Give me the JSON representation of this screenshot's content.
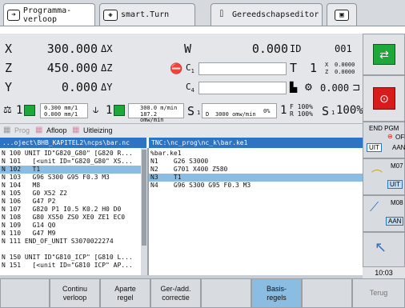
{
  "tabs": [
    {
      "label": "Programma-verloop",
      "icon": "arrow-right-icon"
    },
    {
      "label": "smart.Turn",
      "icon": "diamond-arrow-icon"
    },
    {
      "label": "Gereedschapseditor",
      "icon": "tool-icon"
    },
    {
      "label": "",
      "icon": "save-icon"
    }
  ],
  "positions": {
    "x_axis": "X",
    "x_val": "300.000",
    "x_delta": "ΔX",
    "z_axis": "Z",
    "z_val": "450.000",
    "z_delta": "ΔZ",
    "y_axis": "Y",
    "y_val": "0.000",
    "y_delta": "ΔY",
    "w_axis": "W",
    "w_val": "0.000",
    "id_label": "ID",
    "id_val": "001",
    "c1_label": "C",
    "c1_sub": "1",
    "c4_label": "C",
    "c4_sub": "4",
    "t_label": "T",
    "t_val": "1",
    "x_offset": "0.0000",
    "z_offset": "0.0000",
    "x_offset_label": "X",
    "z_offset_label": "Z",
    "spindle_val": "0.000"
  },
  "status": {
    "feed1_num": "1",
    "feed_top": "0.300 mm/1",
    "feed_bottom": "0.000 mm/1",
    "spindle_num": "1",
    "spindle_top": "300.0 m/min",
    "spindle_bottom": "187.2 omw/min",
    "s_label": "S",
    "s_sub": "1",
    "s_d_label": "D",
    "s_d_val": "3000 omw/min",
    "pct": "0%",
    "t1": "1",
    "f_label": "F",
    "f_pct": "100%",
    "r_label": "R",
    "r_pct": "100%",
    "s_right": "S",
    "s_right_sub": "1",
    "s_right_pct": "100%"
  },
  "modes": {
    "prog": "Prog",
    "afloop": "Afloop",
    "uitleizing": "Uitleizing"
  },
  "left_pane": {
    "header": "...oject\\BHB_KAPITEL2\\ncps\\bar.nc",
    "lines": [
      "N 100 UNIT ID\"G820_G80\" [G820 R...",
      "N 101   [<unit ID=\"G820_G80\" XS...",
      "N 102   T1",
      "N 103   G96 S300 G95 F0.3 M3",
      "N 104   M8",
      "N 105   G0 X52 Z2",
      "N 106   G47 P2",
      "N 107   G820 P1 I0.5 K0.2 H0 D0",
      "N 108   G80 XS50 ZS0 XE0 ZE1 EC0",
      "N 109   G14 Q0",
      "N 110   G47 M9",
      "N 111 END_OF_UNIT S3070022274",
      "",
      "N 150 UNIT ID\"G810_ICP\" [G810 L...",
      "N 151   [<unit ID=\"G810 ICP\" AP..."
    ],
    "selected": 2
  },
  "right_pane": {
    "header": "TNC:\\nc_prog\\nc_k\\bar.ke1",
    "lines": [
      "%bar.ke1",
      "N1    G26 S3000",
      "N2    G701 X400 Z580",
      "N3    T1",
      "N4    G96 S300 G95 F0.3 M3"
    ],
    "selected": 3
  },
  "right_softkeys": {
    "end_pgm": "END PGM",
    "off": "OFF",
    "aan": "AAN",
    "uit": "UIT",
    "m07": "M07",
    "uit2": "UIT",
    "m08": "M08",
    "aan2": "AAN",
    "clock": "10:03"
  },
  "bottom_softkeys": {
    "b1": "",
    "b2": "Continu\nverloop",
    "b3": "Aparte\nregel",
    "b4": "Ger-/add.\ncorrectie",
    "b5": "",
    "b6": "Basis-\nregels",
    "b7": "",
    "b8": "Terug"
  },
  "colors": {
    "accent": "#2d74c4",
    "selection": "#8bbde3",
    "green": "#1fa83a",
    "red": "#d81c1c",
    "bar_pink": "#d58aa5"
  }
}
